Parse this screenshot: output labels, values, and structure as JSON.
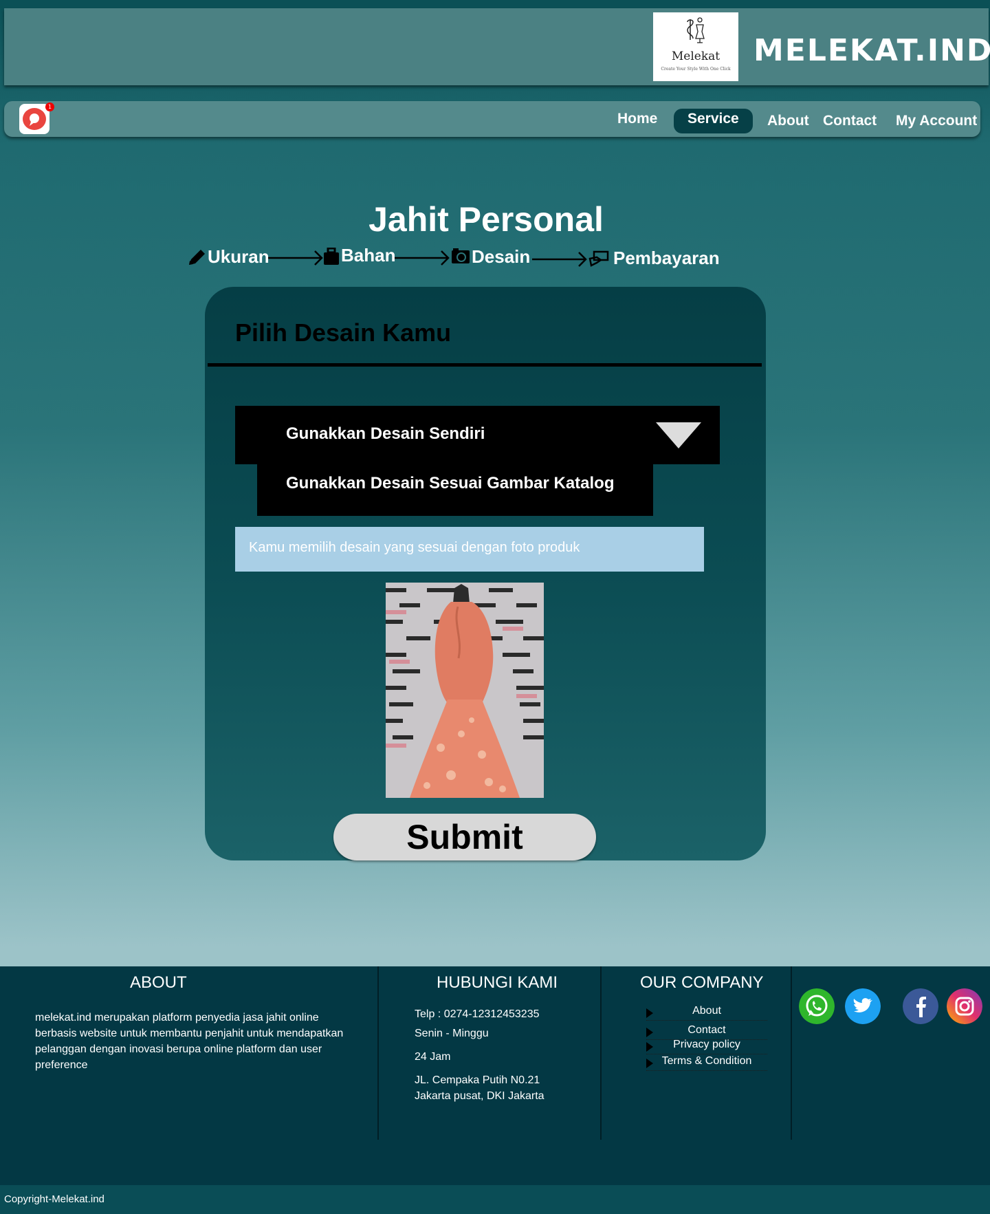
{
  "header": {
    "logo": {
      "name": "Melekat",
      "tagline": "Create Your Style With One Click"
    },
    "brand": "MELEKAT.IND"
  },
  "nav": {
    "notification_count": "1",
    "items": [
      {
        "label": "Home"
      },
      {
        "label": "Service",
        "active": true
      },
      {
        "label": "About"
      },
      {
        "label": "Contact"
      },
      {
        "label": "My Account"
      }
    ]
  },
  "main": {
    "title": "Jahit Personal",
    "steps": [
      {
        "label": "Ukuran",
        "icon": "pencil-icon"
      },
      {
        "label": "Bahan",
        "icon": "toolbox-icon"
      },
      {
        "label": "Desain",
        "icon": "camera-icon"
      },
      {
        "label": "Pembayaran",
        "icon": "hand-money-icon"
      }
    ]
  },
  "card": {
    "title": "Pilih Desain Kamu",
    "dropdown_selected": "Gunakkan Desain Sendiri",
    "dropdown_option": "Gunakkan Desain Sesuai Gambar Katalog",
    "info_text": "Kamu memilih desain yang sesuai dengan foto produk",
    "submit_label": "Submit"
  },
  "footer": {
    "about": {
      "heading": "ABOUT",
      "text": "melekat.ind merupakan platform penyedia jasa jahit online berbasis website untuk membantu penjahit untuk mendapatkan pelanggan dengan inovasi berupa online platform dan user preference"
    },
    "contact": {
      "heading": "HUBUNGI KAMI",
      "phone": "Telp  :  0274-12312453235",
      "days": "Senin - Minggu",
      "hours": "24 Jam",
      "address_line1": "JL. Cempaka Putih N0.21",
      "address_line2": "Jakarta pusat, DKI Jakarta"
    },
    "company": {
      "heading": "OUR COMPANY",
      "links": [
        "About",
        "Contact",
        "Privacy policy",
        "Terms & Condition"
      ]
    },
    "social": [
      "whatsapp-icon",
      "twitter-icon",
      "facebook-icon",
      "instagram-icon"
    ]
  },
  "copyright": "Copyright-Melekat.ind",
  "colors": {
    "header_bg": "#4b8183",
    "nav_active": "#064047",
    "card_bg": "#053e45",
    "footer_bg": "#033844",
    "info_bg": "#a9cfe6"
  }
}
